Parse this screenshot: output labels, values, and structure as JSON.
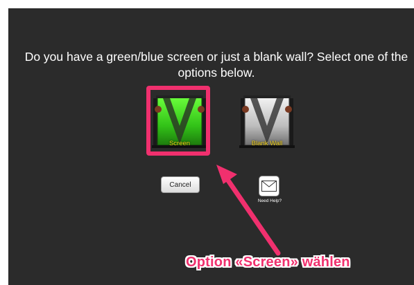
{
  "prompt": {
    "line1": "Do you have a green/blue screen or just a blank wall?  Select one of the",
    "line2": "options below."
  },
  "options": [
    {
      "label": "Screen",
      "icon": "green-screen-icon",
      "color": "#3fcc1e"
    },
    {
      "label": "Blank Wall",
      "icon": "blank-wall-icon",
      "color": "#d8d8d8"
    }
  ],
  "cancel_label": "Cancel",
  "help": {
    "label": "Need Help?",
    "icon": "mail-icon"
  },
  "annotation": {
    "text": "Option «Screen» wählen",
    "color": "#f0306e"
  },
  "colors": {
    "background": "#2b2b2b",
    "label": "#f2d21a",
    "highlight": "#f0306e"
  }
}
